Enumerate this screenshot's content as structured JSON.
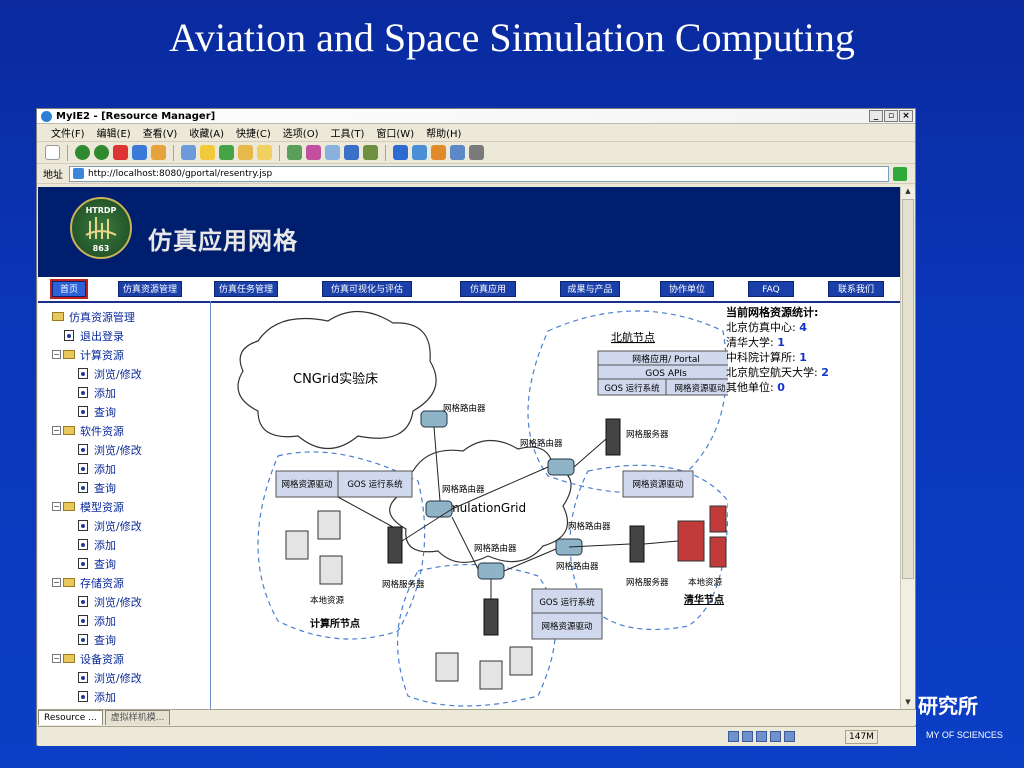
{
  "slide": {
    "title": "Aviation and Space Simulation Computing",
    "corner_text": "研究所",
    "corner_sub": "MY OF SCIENCES"
  },
  "window": {
    "title": "MyIE2 - [Resource Manager]"
  },
  "menu": [
    "文件(F)",
    "编辑(E)",
    "查看(V)",
    "收藏(A)",
    "快捷(C)",
    "选项(O)",
    "工具(T)",
    "窗口(W)",
    "帮助(H)"
  ],
  "address": {
    "label": "地址",
    "url": "http://localhost:8080/gportal/resentry.jsp"
  },
  "site": {
    "logo_top": "HTRDP",
    "logo_bottom": "863",
    "name": "仿真应用网格",
    "nav": [
      "首页",
      "仿真资源管理",
      "仿真任务管理",
      "仿真可视化与评估",
      "仿真应用",
      "成果与产品",
      "协作单位",
      "FAQ",
      "联系我们"
    ]
  },
  "tree": {
    "root": "仿真资源管理",
    "logout": "退出登录",
    "groups": [
      {
        "label": "计算资源",
        "items": [
          "浏览/修改",
          "添加",
          "查询"
        ]
      },
      {
        "label": "软件资源",
        "items": [
          "浏览/修改",
          "添加",
          "查询"
        ]
      },
      {
        "label": "模型资源",
        "items": [
          "浏览/修改",
          "添加",
          "查询"
        ]
      },
      {
        "label": "存储资源",
        "items": [
          "浏览/修改",
          "添加",
          "查询"
        ]
      },
      {
        "label": "设备资源",
        "items": [
          "浏览/修改",
          "添加"
        ]
      }
    ]
  },
  "stats": {
    "title": "当前网格资源统计:",
    "rows": [
      {
        "label": "北京仿真中心:",
        "value": "4"
      },
      {
        "label": "清华大学:",
        "value": "1"
      },
      {
        "label": "中科院计算所:",
        "value": "1"
      },
      {
        "label": "北京航空航天大学:",
        "value": "2"
      },
      {
        "label": "其他单位:",
        "value": "0"
      }
    ]
  },
  "diagram": {
    "cngrid": "CNGrid实验床",
    "simgrid": "SimulationGrid",
    "beihang": "北航节点",
    "portal": "网格应用/ Portal",
    "gos_apis": "GOS APIs",
    "gos_os": "GOS 运行系统",
    "grid_driver": "网格资源驱动",
    "router": "网格路由器",
    "server": "网格服务器",
    "local_res": "本地资源",
    "jisuansuo": "计算所节点",
    "qinghua": "清华节点"
  },
  "tabs": [
    "Resource ...",
    "虚拟样机模..."
  ],
  "status": {
    "mem": "147M"
  }
}
